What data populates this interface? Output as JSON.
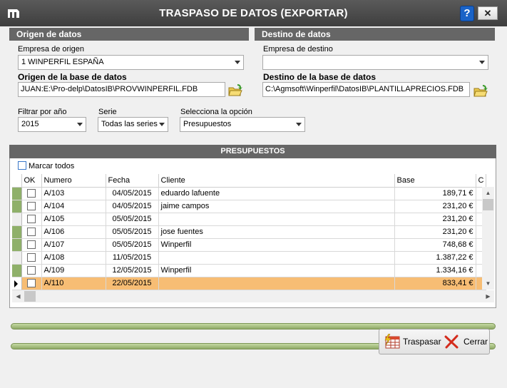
{
  "window": {
    "title": "TRASPASO DE DATOS (EXPORTAR)",
    "help_label": "?",
    "close_label": "✕"
  },
  "origin": {
    "section_title": "Origen de datos",
    "company_label": "Empresa de origen",
    "company_value": "1  WINPERFIL ESPAÑA",
    "db_label": "Origen de la base de datos",
    "db_path": "JUAN:E:\\Pro-delp\\DatosIB\\PROVWINPERFIL.FDB"
  },
  "destination": {
    "section_title": "Destino de datos",
    "company_label": "Empresa de destino",
    "company_value": "",
    "db_label": "Destino de la base de datos",
    "db_path": "C:\\Agmsoft\\Winperfil\\DatosIB\\PLANTILLAPRECIOS.FDB"
  },
  "filters": {
    "year_label": "Filtrar por año",
    "year_value": "2015",
    "series_label": "Serie",
    "series_value": "Todas las series",
    "option_label": "Selecciona la opción",
    "option_value": "Presupuestos"
  },
  "grid": {
    "title": "PRESUPUESTOS",
    "select_all_label": "Marcar todos",
    "columns": [
      "OK",
      "Numero",
      "Fecha",
      "Cliente",
      "Base",
      "C"
    ],
    "rows": [
      {
        "numero": "A/103",
        "fecha": "04/05/2015",
        "cliente": "eduardo lafuente",
        "base": "189,71 €"
      },
      {
        "numero": "A/104",
        "fecha": "04/05/2015",
        "cliente": "jaime campos",
        "base": "231,20 €"
      },
      {
        "numero": "A/105",
        "fecha": "05/05/2015",
        "cliente": "",
        "base": "231,20 €"
      },
      {
        "numero": "A/106",
        "fecha": "05/05/2015",
        "cliente": "jose fuentes",
        "base": "231,20 €"
      },
      {
        "numero": "A/107",
        "fecha": "05/05/2015",
        "cliente": "Winperfil",
        "base": "748,68 €"
      },
      {
        "numero": "A/108",
        "fecha": "11/05/2015",
        "cliente": "",
        "base": "1.387,22 €"
      },
      {
        "numero": "A/109",
        "fecha": "12/05/2015",
        "cliente": "Winperfil",
        "base": "1.334,16 €"
      },
      {
        "numero": "A/110",
        "fecha": "22/05/2015",
        "cliente": "",
        "base": "833,41 €"
      }
    ]
  },
  "buttons": {
    "transfer_label": "Traspasar",
    "close_label": "Cerrar"
  },
  "colors": {
    "selected_row": "#f7bd74",
    "row_indicator": "#8fb06a",
    "header_bg": "#666666"
  }
}
